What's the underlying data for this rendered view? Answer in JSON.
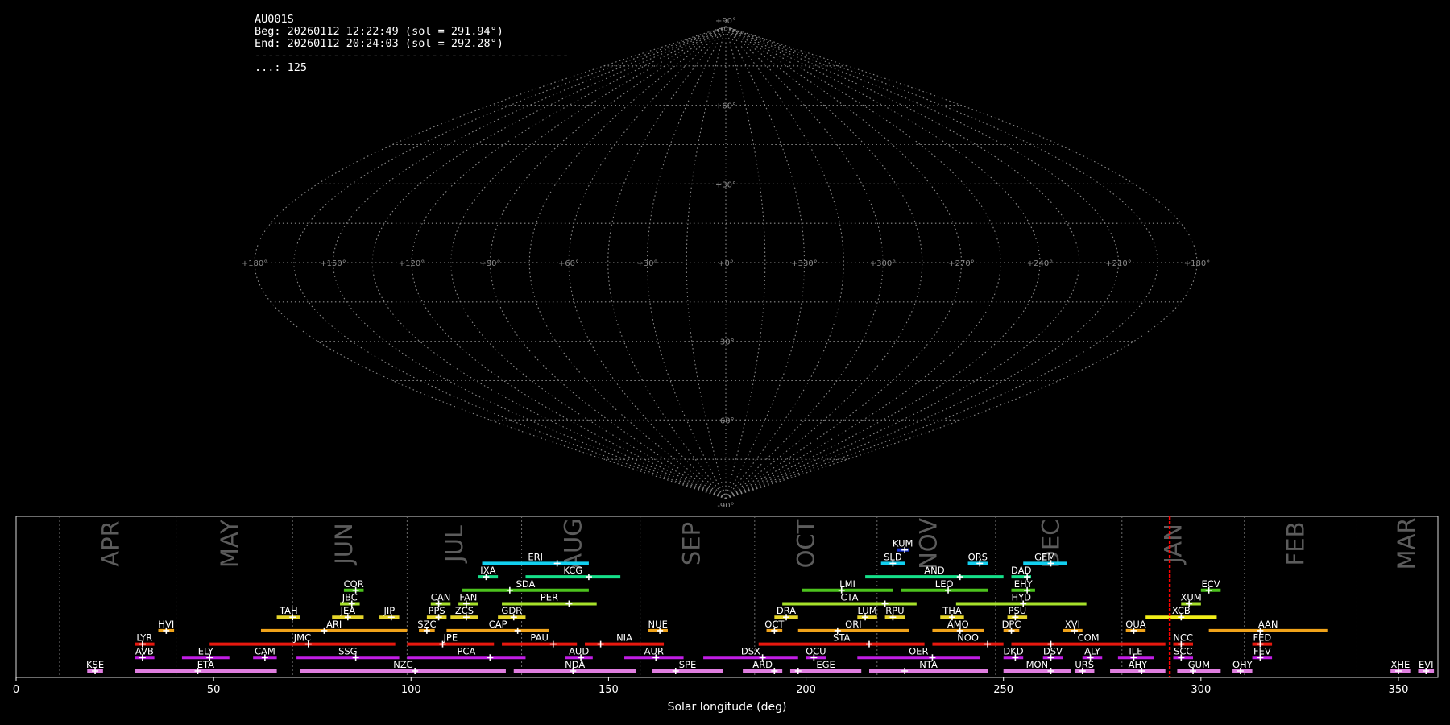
{
  "info": {
    "station": "AU001S",
    "beg": "Beg: 20260112 12:22:49 (sol = 291.94°)",
    "end": "End: 20260112 20:24:03 (sol = 292.28°)",
    "separator": "------------------------------------------------",
    "count": "...: 125"
  },
  "chart_data": [
    {
      "type": "sky-map",
      "projection": "sinusoidal",
      "grid": true,
      "lat_labels": [
        "+90°",
        "+60°",
        "+30°",
        "-30°",
        "-60°",
        "-90°"
      ],
      "lon_labels": [
        "+180°",
        "+150°",
        "+120°",
        "+90°",
        "+60°",
        "+30°",
        "+0°",
        "+330°",
        "+300°",
        "+270°",
        "+240°",
        "+210°",
        "+180°"
      ],
      "colors": {
        "grid": "#8a8a8a",
        "background": "#000000"
      }
    },
    {
      "type": "timeline",
      "xlabel": "Solar longitude (deg)",
      "xlim": [
        0,
        360
      ],
      "x_ticks": [
        0,
        50,
        100,
        150,
        200,
        250,
        300,
        350
      ],
      "current_sol": 292.1,
      "months": [
        {
          "name": "APR",
          "start": 11,
          "label_x": 24
        },
        {
          "name": "MAY",
          "start": 40.5,
          "label_x": 54
        },
        {
          "name": "JUN",
          "start": 70,
          "label_x": 83
        },
        {
          "name": "JUL",
          "start": 99,
          "label_x": 111
        },
        {
          "name": "AUG",
          "start": 128,
          "label_x": 141
        },
        {
          "name": "SEP",
          "start": 158,
          "label_x": 171
        },
        {
          "name": "OCT",
          "start": 187,
          "label_x": 200
        },
        {
          "name": "NOV",
          "start": 218,
          "label_x": 231
        },
        {
          "name": "DEC",
          "start": 248,
          "label_x": 262
        },
        {
          "name": "JAN",
          "start": 280,
          "label_x": 293
        },
        {
          "name": "FEB",
          "start": 311,
          "label_x": 324
        },
        {
          "name": "MAR",
          "start": 339.5,
          "label_x": 352
        }
      ],
      "showers": [
        {
          "code": "KUM",
          "start": 223,
          "end": 226,
          "peak": 225,
          "row": 9,
          "color": "#1530d8"
        },
        {
          "code": "ERI",
          "start": 118,
          "end": 145,
          "peak": 137,
          "row": 8,
          "color": "#12d0f0"
        },
        {
          "code": "SLD",
          "start": 219,
          "end": 225,
          "peak": 222,
          "row": 8,
          "color": "#12d0f0"
        },
        {
          "code": "ORS",
          "start": 241,
          "end": 246,
          "peak": 244,
          "row": 8,
          "color": "#12d0f0"
        },
        {
          "code": "GEM",
          "start": 255,
          "end": 266,
          "peak": 262,
          "row": 8,
          "color": "#12d0f0"
        },
        {
          "code": "IXA",
          "start": 117,
          "end": 122,
          "peak": 119,
          "row": 7,
          "color": "#15e08a"
        },
        {
          "code": "KCG",
          "start": 129,
          "end": 153,
          "peak": 145,
          "row": 7,
          "color": "#15e08a"
        },
        {
          "code": "AND",
          "start": 215,
          "end": 250,
          "peak": 239,
          "row": 7,
          "color": "#15e08a"
        },
        {
          "code": "DAD",
          "start": 252,
          "end": 257,
          "peak": 256,
          "row": 7,
          "color": "#15e08a"
        },
        {
          "code": "COR",
          "start": 83,
          "end": 88,
          "peak": 86,
          "row": 6,
          "color": "#4cc21d"
        },
        {
          "code": "SDA",
          "start": 113,
          "end": 145,
          "peak": 125,
          "row": 6,
          "color": "#4cc21d"
        },
        {
          "code": "LMI",
          "start": 199,
          "end": 222,
          "peak": 209,
          "row": 6,
          "color": "#4cc21d"
        },
        {
          "code": "LEO",
          "start": 224,
          "end": 246,
          "peak": 236,
          "row": 6,
          "color": "#4cc21d"
        },
        {
          "code": "EHY",
          "start": 252,
          "end": 258,
          "peak": 256,
          "row": 6,
          "color": "#4cc21d"
        },
        {
          "code": "ECV",
          "start": 300,
          "end": 305,
          "peak": 302,
          "row": 6,
          "color": "#4cc21d"
        },
        {
          "code": "JBC",
          "start": 82,
          "end": 87,
          "peak": 85,
          "row": 5,
          "color": "#a6e02a"
        },
        {
          "code": "CAN",
          "start": 105,
          "end": 110,
          "peak": 107,
          "row": 5,
          "color": "#a6e02a"
        },
        {
          "code": "FAN",
          "start": 112,
          "end": 117,
          "peak": 114,
          "row": 5,
          "color": "#a6e02a"
        },
        {
          "code": "PER",
          "start": 123,
          "end": 147,
          "peak": 140,
          "row": 5,
          "color": "#a6e02a"
        },
        {
          "code": "CTA",
          "start": 194,
          "end": 228,
          "peak": 220,
          "row": 5,
          "color": "#a6e02a"
        },
        {
          "code": "HYD",
          "start": 238,
          "end": 271,
          "peak": 255,
          "row": 5,
          "color": "#a6e02a"
        },
        {
          "code": "XUM",
          "start": 295,
          "end": 300,
          "peak": 297,
          "row": 5,
          "color": "#a6e02a"
        },
        {
          "code": "TAH",
          "start": 66,
          "end": 72,
          "peak": 70,
          "row": 4,
          "color": "#e6d52a"
        },
        {
          "code": "JEA",
          "start": 80,
          "end": 88,
          "peak": 84,
          "row": 4,
          "color": "#e6d52a"
        },
        {
          "code": "JIP",
          "start": 92,
          "end": 97,
          "peak": 95,
          "row": 4,
          "color": "#e6d52a"
        },
        {
          "code": "PPS",
          "start": 104,
          "end": 109,
          "peak": 107,
          "row": 4,
          "color": "#e6d52a"
        },
        {
          "code": "ZCS",
          "start": 110,
          "end": 117,
          "peak": 114,
          "row": 4,
          "color": "#e6d52a"
        },
        {
          "code": "GDR",
          "start": 122,
          "end": 129,
          "peak": 126,
          "row": 4,
          "color": "#e6d52a"
        },
        {
          "code": "DRA",
          "start": 192,
          "end": 198,
          "peak": 195,
          "row": 4,
          "color": "#e6d52a"
        },
        {
          "code": "LUM",
          "start": 213,
          "end": 218,
          "peak": 215,
          "row": 4,
          "color": "#e6d52a"
        },
        {
          "code": "RPU",
          "start": 220,
          "end": 225,
          "peak": 222,
          "row": 4,
          "color": "#e6d52a"
        },
        {
          "code": "THA",
          "start": 234,
          "end": 240,
          "peak": 237,
          "row": 4,
          "color": "#e6d52a"
        },
        {
          "code": "PSU",
          "start": 251,
          "end": 256,
          "peak": 253,
          "row": 4,
          "color": "#e6d52a"
        },
        {
          "code": "XCB",
          "start": 286,
          "end": 304,
          "peak": 295,
          "row": 4,
          "color": "#f2ee18"
        },
        {
          "code": "HVI",
          "start": 36,
          "end": 40,
          "peak": 38,
          "row": 3,
          "color": "#f0a31a"
        },
        {
          "code": "ARI",
          "start": 62,
          "end": 99,
          "peak": 78,
          "row": 3,
          "color": "#f0a31a"
        },
        {
          "code": "SZC",
          "start": 102,
          "end": 106,
          "peak": 104,
          "row": 3,
          "color": "#f0a31a"
        },
        {
          "code": "CAP",
          "start": 109,
          "end": 135,
          "peak": 127,
          "row": 3,
          "color": "#f0a31a"
        },
        {
          "code": "NUE",
          "start": 160,
          "end": 165,
          "peak": 163,
          "row": 3,
          "color": "#f0a31a"
        },
        {
          "code": "OCT",
          "start": 190,
          "end": 194,
          "peak": 192,
          "row": 3,
          "color": "#f0a31a"
        },
        {
          "code": "ORI",
          "start": 198,
          "end": 226,
          "peak": 208,
          "row": 3,
          "color": "#f0a31a"
        },
        {
          "code": "AMO",
          "start": 232,
          "end": 245,
          "peak": 239,
          "row": 3,
          "color": "#f0a31a"
        },
        {
          "code": "DPC",
          "start": 250,
          "end": 254,
          "peak": 252,
          "row": 3,
          "color": "#f0a31a"
        },
        {
          "code": "XVI",
          "start": 265,
          "end": 270,
          "peak": 268,
          "row": 3,
          "color": "#f0a31a"
        },
        {
          "code": "QUA",
          "start": 281,
          "end": 286,
          "peak": 283,
          "row": 3,
          "color": "#f0a31a"
        },
        {
          "code": "AAN",
          "start": 302,
          "end": 332,
          "peak": 315,
          "row": 3,
          "color": "#f0a31a"
        },
        {
          "code": "LYR",
          "start": 30,
          "end": 35,
          "peak": 32,
          "row": 2,
          "color": "#e8180e"
        },
        {
          "code": "JMC",
          "start": 49,
          "end": 96,
          "peak": 74,
          "row": 2,
          "color": "#e8180e"
        },
        {
          "code": "JPE",
          "start": 99,
          "end": 121,
          "peak": 108,
          "row": 2,
          "color": "#e8180e"
        },
        {
          "code": "PAU",
          "start": 123,
          "end": 142,
          "peak": 136,
          "row": 2,
          "color": "#e8180e"
        },
        {
          "code": "NIA",
          "start": 144,
          "end": 164,
          "peak": 148,
          "row": 2,
          "color": "#e8180e"
        },
        {
          "code": "STA",
          "start": 188,
          "end": 230,
          "peak": 216,
          "row": 2,
          "color": "#e8180e"
        },
        {
          "code": "NOO",
          "start": 232,
          "end": 250,
          "peak": 246,
          "row": 2,
          "color": "#e8180e"
        },
        {
          "code": "COM",
          "start": 252,
          "end": 291,
          "peak": 262,
          "row": 2,
          "color": "#e8180e"
        },
        {
          "code": "NCC",
          "start": 293,
          "end": 298,
          "peak": 295,
          "row": 2,
          "color": "#e8180e"
        },
        {
          "code": "FED",
          "start": 313,
          "end": 318,
          "peak": 315,
          "row": 2,
          "color": "#e8180e"
        },
        {
          "code": "AVB",
          "start": 30,
          "end": 35,
          "peak": 32,
          "row": 1,
          "color": "#c21ee6"
        },
        {
          "code": "ELY",
          "start": 42,
          "end": 54,
          "peak": 49,
          "row": 1,
          "color": "#c21ee6"
        },
        {
          "code": "CAM",
          "start": 60,
          "end": 66,
          "peak": 63,
          "row": 1,
          "color": "#c21ee6"
        },
        {
          "code": "SSG",
          "start": 71,
          "end": 97,
          "peak": 86,
          "row": 1,
          "color": "#c21ee6"
        },
        {
          "code": "PCA",
          "start": 99,
          "end": 129,
          "peak": 120,
          "row": 1,
          "color": "#c21ee6"
        },
        {
          "code": "AUD",
          "start": 139,
          "end": 146,
          "peak": 143,
          "row": 1,
          "color": "#c21ee6"
        },
        {
          "code": "AUR",
          "start": 154,
          "end": 169,
          "peak": 162,
          "row": 1,
          "color": "#c21ee6"
        },
        {
          "code": "DSX",
          "start": 174,
          "end": 198,
          "peak": 189,
          "row": 1,
          "color": "#c21ee6"
        },
        {
          "code": "OCU",
          "start": 200,
          "end": 205,
          "peak": 202,
          "row": 1,
          "color": "#c21ee6"
        },
        {
          "code": "OER",
          "start": 213,
          "end": 244,
          "peak": 232,
          "row": 1,
          "color": "#c21ee6"
        },
        {
          "code": "DKD",
          "start": 250,
          "end": 255,
          "peak": 253,
          "row": 1,
          "color": "#c21ee6"
        },
        {
          "code": "DSV",
          "start": 260,
          "end": 265,
          "peak": 262,
          "row": 1,
          "color": "#c21ee6"
        },
        {
          "code": "ALY",
          "start": 270,
          "end": 275,
          "peak": 272,
          "row": 1,
          "color": "#c21ee6"
        },
        {
          "code": "ILE",
          "start": 279,
          "end": 288,
          "peak": 283,
          "row": 1,
          "color": "#c21ee6"
        },
        {
          "code": "SCC",
          "start": 293,
          "end": 298,
          "peak": 295,
          "row": 1,
          "color": "#c21ee6"
        },
        {
          "code": "FEV",
          "start": 313,
          "end": 318,
          "peak": 315,
          "row": 1,
          "color": "#c21ee6"
        },
        {
          "code": "KSE",
          "start": 18,
          "end": 22,
          "peak": 20,
          "row": 0,
          "color": "#e07ee0"
        },
        {
          "code": "ETA",
          "start": 30,
          "end": 66,
          "peak": 46,
          "row": 0,
          "color": "#e07ee0"
        },
        {
          "code": "NZC",
          "start": 72,
          "end": 124,
          "peak": 101,
          "row": 0,
          "color": "#e07ee0"
        },
        {
          "code": "NDA",
          "start": 126,
          "end": 157,
          "peak": 141,
          "row": 0,
          "color": "#e07ee0"
        },
        {
          "code": "SPE",
          "start": 161,
          "end": 179,
          "peak": 167,
          "row": 0,
          "color": "#e07ee0"
        },
        {
          "code": "ARD",
          "start": 184,
          "end": 194,
          "peak": 192,
          "row": 0,
          "color": "#e07ee0"
        },
        {
          "code": "EGE",
          "start": 196,
          "end": 214,
          "peak": 198,
          "row": 0,
          "color": "#e07ee0"
        },
        {
          "code": "NTA",
          "start": 216,
          "end": 246,
          "peak": 225,
          "row": 0,
          "color": "#e07ee0"
        },
        {
          "code": "MON",
          "start": 250,
          "end": 267,
          "peak": 262,
          "row": 0,
          "color": "#e07ee0"
        },
        {
          "code": "URS",
          "start": 268,
          "end": 273,
          "peak": 270,
          "row": 0,
          "color": "#e07ee0"
        },
        {
          "code": "AHY",
          "start": 277,
          "end": 291,
          "peak": 285,
          "row": 0,
          "color": "#e07ee0"
        },
        {
          "code": "GUM",
          "start": 294,
          "end": 305,
          "peak": 298,
          "row": 0,
          "color": "#e07ee0"
        },
        {
          "code": "OHY",
          "start": 308,
          "end": 313,
          "peak": 310,
          "row": 0,
          "color": "#e07ee0"
        },
        {
          "code": "XHE",
          "start": 348,
          "end": 353,
          "peak": 350,
          "row": 0,
          "color": "#e07ee0"
        },
        {
          "code": "EVI",
          "start": 355,
          "end": 359,
          "peak": 357,
          "row": 0,
          "color": "#e07ee0"
        }
      ]
    }
  ]
}
